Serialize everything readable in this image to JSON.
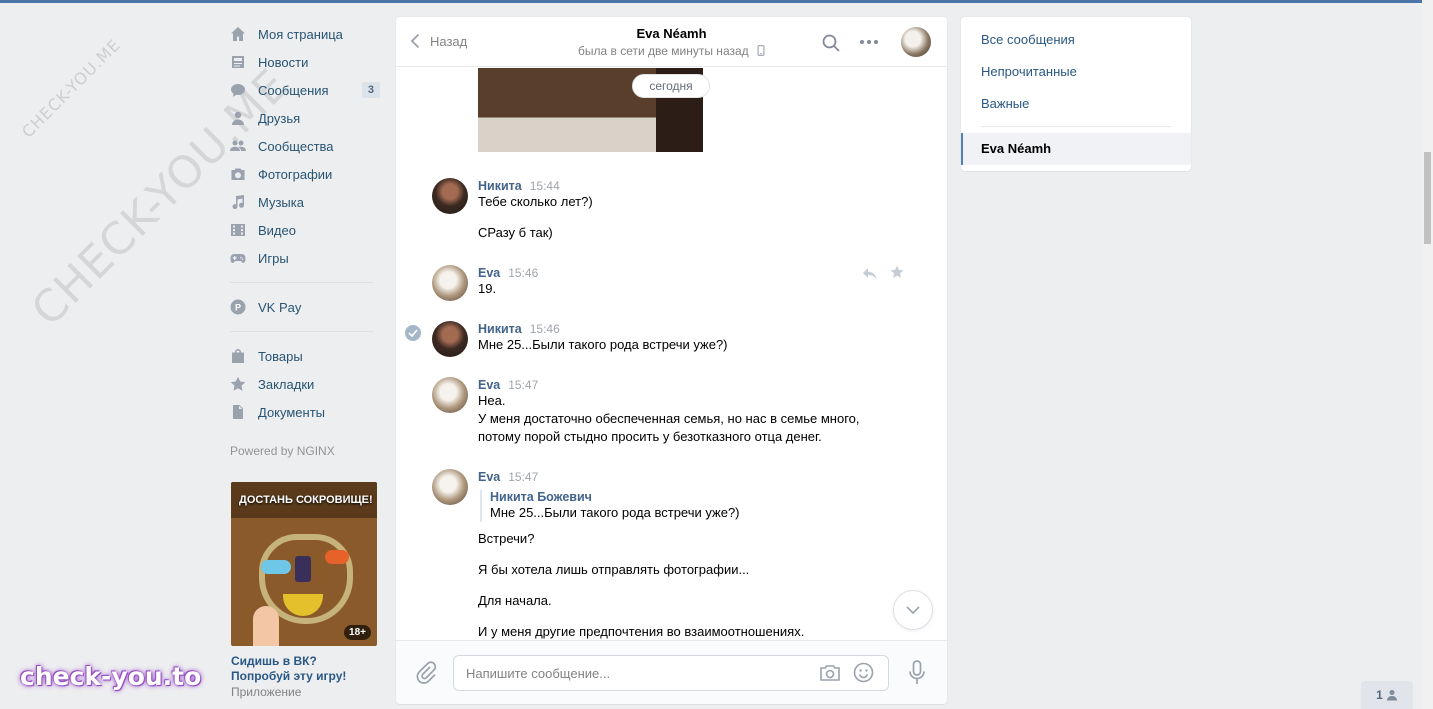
{
  "watermarks": {
    "small": "CHECK-YOU.ME",
    "big": "CHECK-YOU.ME",
    "brand": "check-you.to"
  },
  "nav": {
    "items": [
      {
        "label": "Моя страница",
        "icon": "home-icon"
      },
      {
        "label": "Новости",
        "icon": "news-icon"
      },
      {
        "label": "Сообщения",
        "icon": "messages-icon",
        "badge": "3"
      },
      {
        "label": "Друзья",
        "icon": "friends-icon"
      },
      {
        "label": "Сообщества",
        "icon": "communities-icon"
      },
      {
        "label": "Фотографии",
        "icon": "camera-icon"
      },
      {
        "label": "Музыка",
        "icon": "music-icon"
      },
      {
        "label": "Видео",
        "icon": "video-icon"
      },
      {
        "label": "Игры",
        "icon": "games-icon"
      }
    ],
    "pay": {
      "label": "VK Pay",
      "icon": "vkpay-icon"
    },
    "extra": [
      {
        "label": "Товары",
        "icon": "bag-icon"
      },
      {
        "label": "Закладки",
        "icon": "star-icon"
      },
      {
        "label": "Документы",
        "icon": "document-icon"
      }
    ],
    "powered": "Powered by NGINX"
  },
  "ad": {
    "image_title": "ДОСТАНЬ СОКРОВИЩЕ!",
    "age": "18+",
    "caption": "Сидишь в ВК? Попробуй эту игру!",
    "sub": "Приложение"
  },
  "chat": {
    "back_label": "Назад",
    "peer_name": "Eva Néamh",
    "peer_status": "была в сети две минуты назад",
    "date_pill": "сегодня",
    "messages": [
      {
        "author": "Никита",
        "time": "15:44",
        "lines": [
          "Тебе сколько лет?)",
          "СРазу б так)"
        ]
      },
      {
        "author": "Eva",
        "time": "15:46",
        "lines": [
          "19."
        ]
      },
      {
        "author": "Никита",
        "time": "15:46",
        "lines": [
          "Мне 25...Были такого рода встречи уже?)"
        ]
      },
      {
        "author": "Eva",
        "time": "15:47",
        "lines": [
          "Неа.",
          "У меня достаточно обеспеченная семья, но нас в семье много,",
          "потому порой стыдно просить у безотказного отца денег."
        ]
      },
      {
        "author": "Eva",
        "time": "15:47",
        "quote": {
          "author": "Никита Божевич",
          "text": "Мне 25...Были такого рода встречи уже?)"
        },
        "lines": [
          "Встречи?",
          "Я бы хотела лишь отправлять фотографии...",
          "Для начала.",
          "И у меня другие предпочтения во взаимоотношениях."
        ]
      }
    ],
    "composer_placeholder": "Напишите сообщение..."
  },
  "right_menu": {
    "items": [
      "Все сообщения",
      "Непрочитанные",
      "Важные"
    ],
    "active": "Eva Néamh"
  },
  "corner": {
    "count": "1"
  }
}
